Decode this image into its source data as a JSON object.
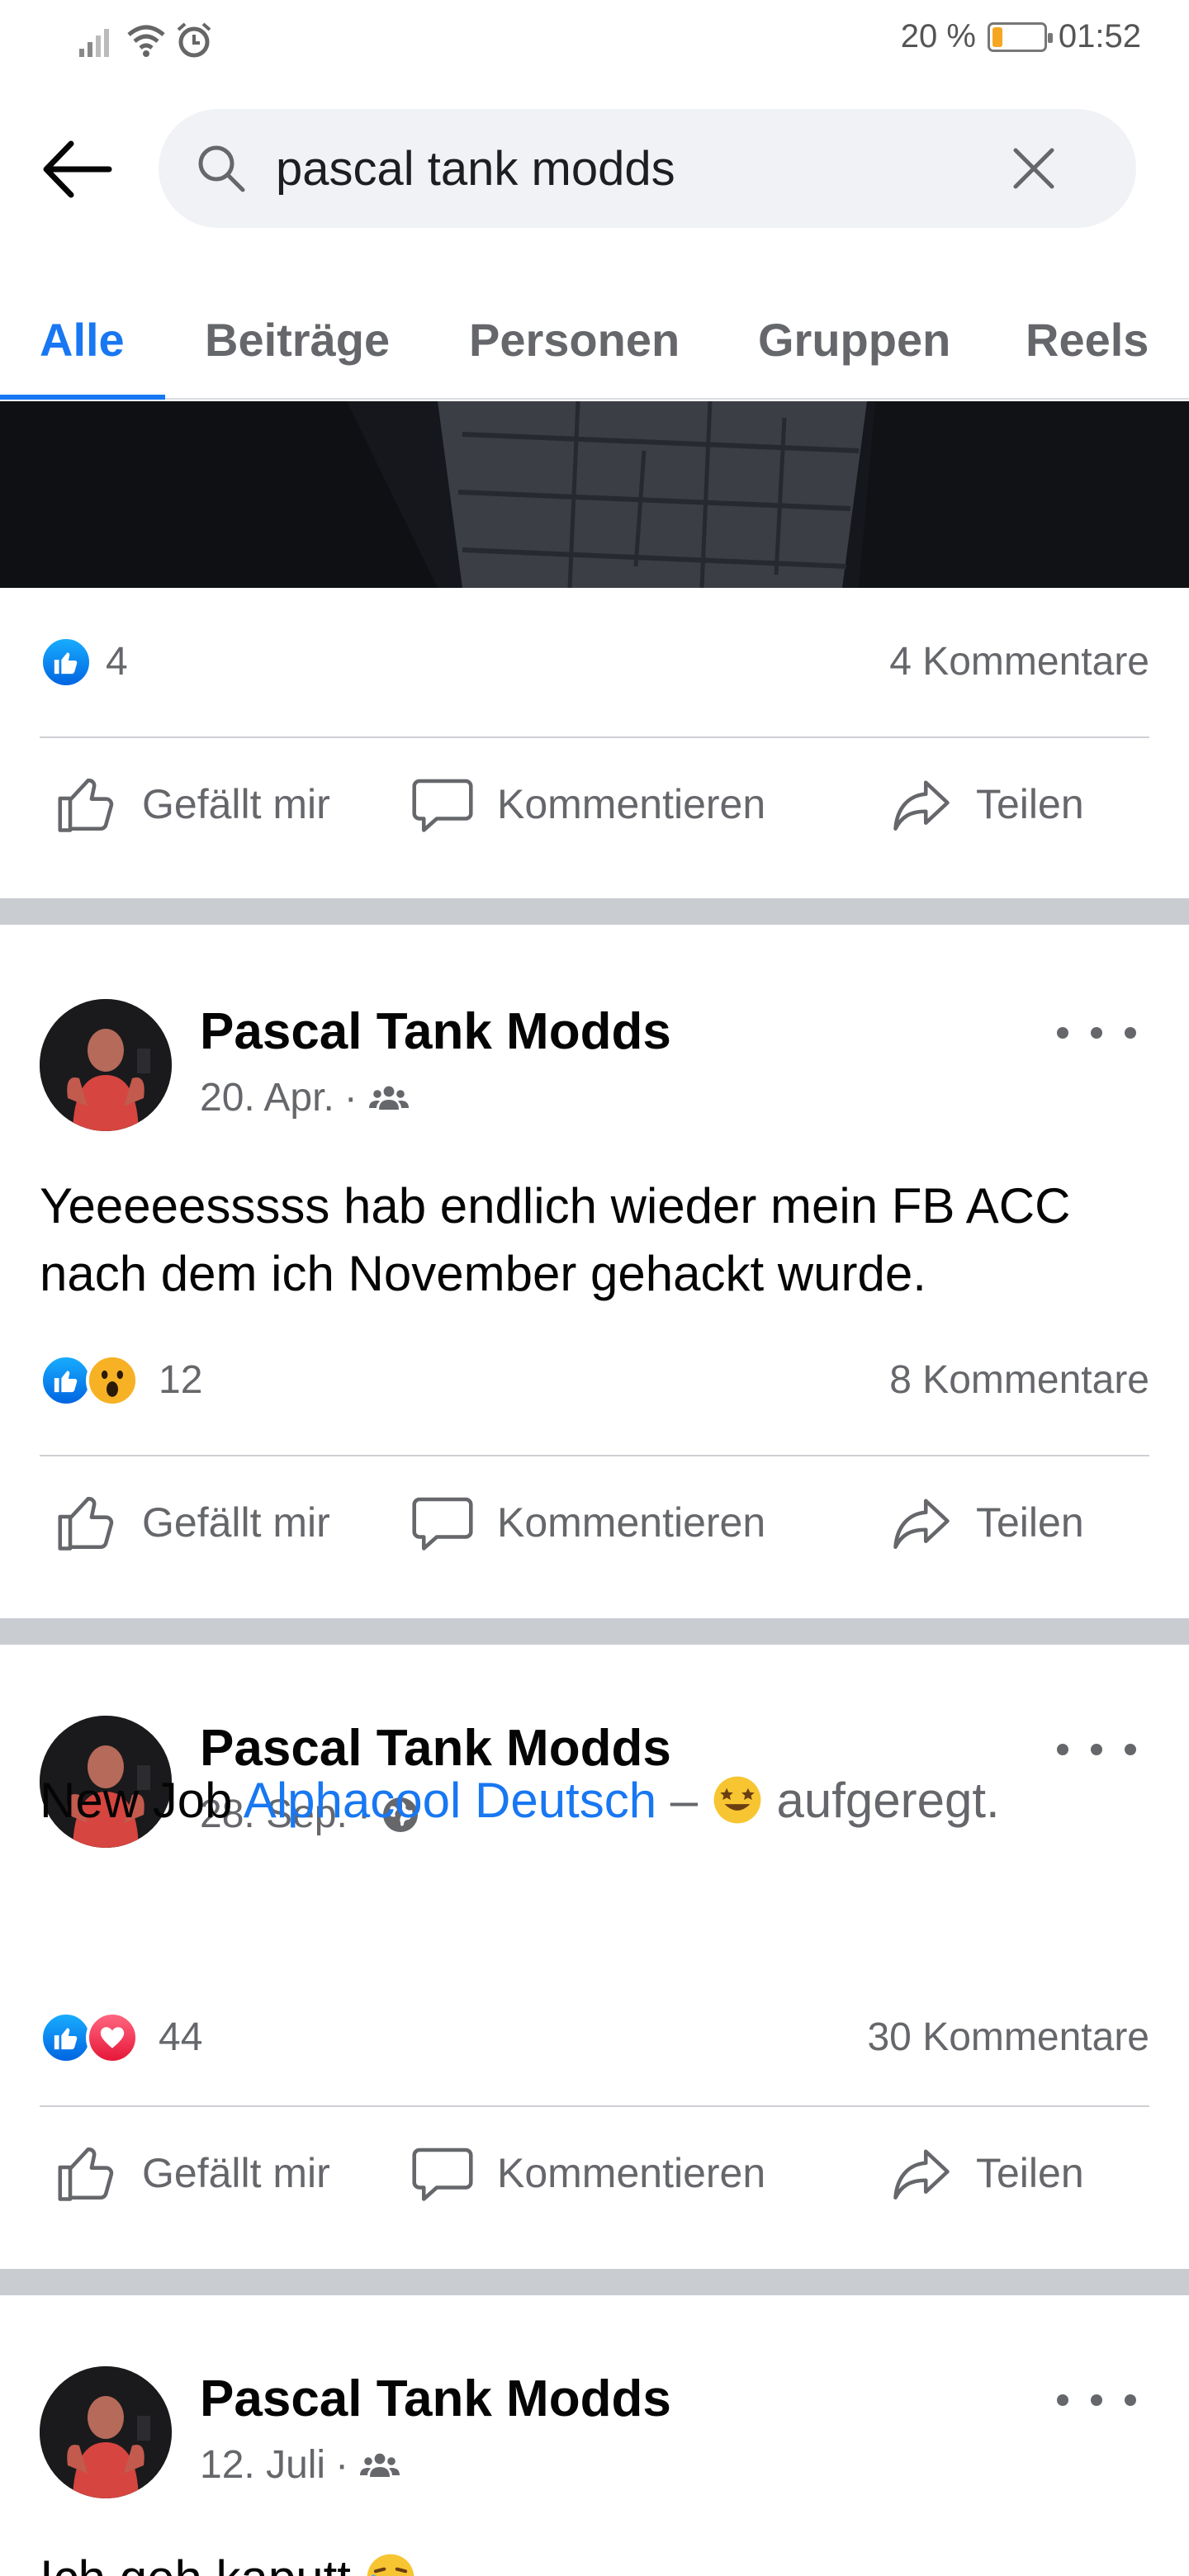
{
  "status_bar": {
    "battery": "20 %",
    "battery_level": 0.2,
    "time": "01:52"
  },
  "search": {
    "query": "pascal tank modds"
  },
  "tabs": [
    {
      "label": "Alle",
      "active": true
    },
    {
      "label": "Beiträge"
    },
    {
      "label": "Personen"
    },
    {
      "label": "Gruppen"
    },
    {
      "label": "Reels"
    }
  ],
  "actions": {
    "like": "Gefällt mir",
    "comment": "Kommentieren",
    "share": "Teilen"
  },
  "posts": [
    {
      "reaction_count": "4",
      "reactions": [
        "like"
      ],
      "comments": "4 Kommentare"
    },
    {
      "author": "Pascal Tank Modds",
      "date": "20. Apr.",
      "privacy": "friends-icon",
      "text": "Yeeeeesssss hab endlich wieder mein FB ACC nach dem ich November gehackt wurde.",
      "reaction_count": "12",
      "reactions": [
        "like",
        "wow"
      ],
      "comments": "8 Kommentare"
    },
    {
      "author": "Pascal Tank Modds",
      "date": "28. Sep.",
      "privacy": "globe-icon",
      "text_prefix": "New Job",
      "text_link": "Alphacool Deutsch",
      "text_sep": "–",
      "feeling": "aufgeregt.",
      "reaction_count": "44",
      "reactions": [
        "like",
        "love"
      ],
      "comments": "30 Kommentare"
    },
    {
      "author": "Pascal Tank Modds",
      "date": "12. Juli",
      "privacy": "friends-icon",
      "text": "Ich geh kaputt"
    }
  ]
}
